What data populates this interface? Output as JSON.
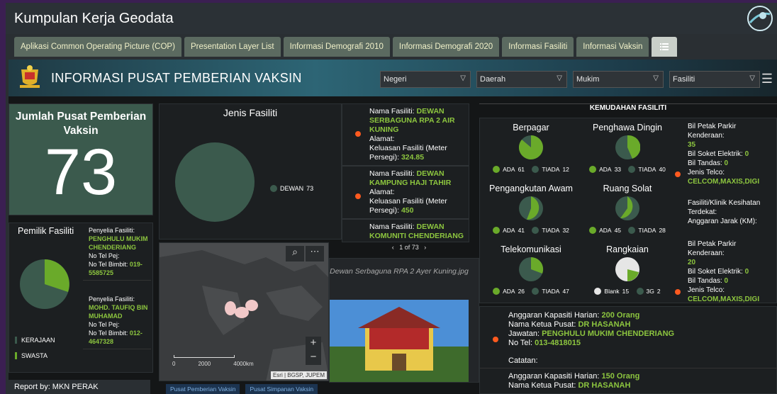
{
  "app": {
    "title": "Kumpulan Kerja Geodata",
    "tabs": [
      "Aplikasi Common Operating Picture (COP)",
      "Presentation Layer List",
      "Informasi Demografi 2010",
      "Informasi Demografi 2020",
      "Informasi Fasiliti",
      "Informasi Vaksin"
    ],
    "menu_tab_icon": "list-icon"
  },
  "dashboard": {
    "title": "INFORMASI PUSAT PEMBERIAN VAKSIN",
    "filters": [
      {
        "label": "Negeri"
      },
      {
        "label": "Daerah"
      },
      {
        "label": "Mukim"
      },
      {
        "label": "Fasiliti"
      }
    ],
    "total": {
      "label": "Jumlah Pusat Pemberian Vaksin",
      "value": "73"
    },
    "owner": {
      "title": "Pemilik Fasiliti",
      "legend": [
        "KERAJAAN",
        "SWASTA"
      ],
      "records": [
        {
          "label": "Penyelia Fasiliti:",
          "name": "PENGHULU MUKIM CHENDERIANG",
          "tel_pej": "No Tel Pej:",
          "tel_bimbit_label": "No Tel Bimbit:",
          "tel_bimbit": "019-5585725"
        },
        {
          "label": "Penyelia Fasiliti:",
          "name": "MOHD. TAUFIQ BIN MUHAMAD",
          "tel_pej": "No Tel Pej:",
          "tel_bimbit_label": "No Tel Bimbit:",
          "tel_bimbit": "012-4647328"
        }
      ]
    },
    "jenis": {
      "title": "Jenis Fasiliti",
      "legend_label": "DEWAN",
      "legend_value": "73"
    },
    "list": [
      {
        "name_label": "Nama Fasiliti:",
        "name": "DEWAN SERBAGUNA RPA 2 AIR KUNING",
        "addr_label": "Alamat:",
        "area_label": "Keluasan Fasiliti (Meter Persegi):",
        "area": "324.85"
      },
      {
        "name_label": "Nama Fasiliti:",
        "name": "DEWAN KAMPUNG HAJI TAHIR",
        "addr_label": "Alamat:",
        "area_label": "Keluasan Fasiliti (Meter Persegi):",
        "area": "450"
      },
      {
        "name_label": "Nama Fasiliti:",
        "name": "DEWAN KOMUNITI CHENDERIANG",
        "addr_label": "",
        "area_label": "",
        "area": ""
      }
    ],
    "pager": "1 of 73",
    "photo": {
      "caption": "Dewan Serbaguna RPA 2 Ayer Kuning.jpg"
    },
    "map": {
      "scale": [
        "0",
        "2000",
        "4000km"
      ],
      "attribution": "Esri | BGSP, JUPEM"
    },
    "amenities": {
      "heading": "KEMUDAHAN FASILITI",
      "charts": [
        {
          "label": "Berpagar",
          "a_label": "ADA",
          "a": 61,
          "b_label": "TIADA",
          "b": 12
        },
        {
          "label": "Penghawa Dingin",
          "a_label": "ADA",
          "a": 33,
          "b_label": "TIADA",
          "b": 40
        },
        {
          "label": "Pengangkutan Awam",
          "a_label": "ADA",
          "a": 41,
          "b_label": "TIADA",
          "b": 32
        },
        {
          "label": "Ruang Solat",
          "a_label": "ADA",
          "a": 45,
          "b_label": "TIADA",
          "b": 28
        },
        {
          "label": "Telekomunikasi",
          "a_label": "ADA",
          "a": 26,
          "b_label": "TIADA",
          "b": 47
        },
        {
          "label": "Rangkaian",
          "a_label": "Blank",
          "a": 15,
          "b_label": "3G",
          "b": 2
        }
      ],
      "side": [
        {
          "lines": [
            "Bil Petak Parkir Kenderaan:",
            "35",
            "Bil Soket Elektrik:",
            "0",
            "Bil Tandas:",
            "0",
            "Jenis Telco:",
            "CELCOM,MAXIS,DIGI"
          ]
        },
        {
          "lines": [
            "Fasiliti/Klinik Kesihatan Terdekat:",
            "Anggaran Jarak (KM):"
          ]
        },
        {
          "lines": [
            "Bil Petak Parkir Kenderaan:",
            "20",
            "Bil Soket Elektrik:",
            "0",
            "Bil Tandas:",
            "0",
            "Jenis Telco:",
            "CELCOM,MAXIS,DIGI"
          ]
        }
      ]
    },
    "capacity": [
      {
        "cap_label": "Anggaran Kapasiti Harian:",
        "cap": "200 Orang",
        "head_label": "Nama Ketua Pusat:",
        "head": "DR HASANAH",
        "post_label": "Jawatan:",
        "post": "PENGHULU MUKIM CHENDERIANG",
        "tel_label": "No Tel:",
        "tel": "013-4818015",
        "note": "Catatan:"
      },
      {
        "cap_label": "Anggaran Kapasiti Harian:",
        "cap": "150 Orang",
        "head_label": "Nama Ketua Pusat:",
        "head": "DR HASANAH"
      }
    ],
    "report": "Report by: MKN PERAK",
    "bottom_tabs": [
      "Pusat Pemberian Vaksin",
      "Pusat Simpanan Vaksin"
    ]
  }
}
